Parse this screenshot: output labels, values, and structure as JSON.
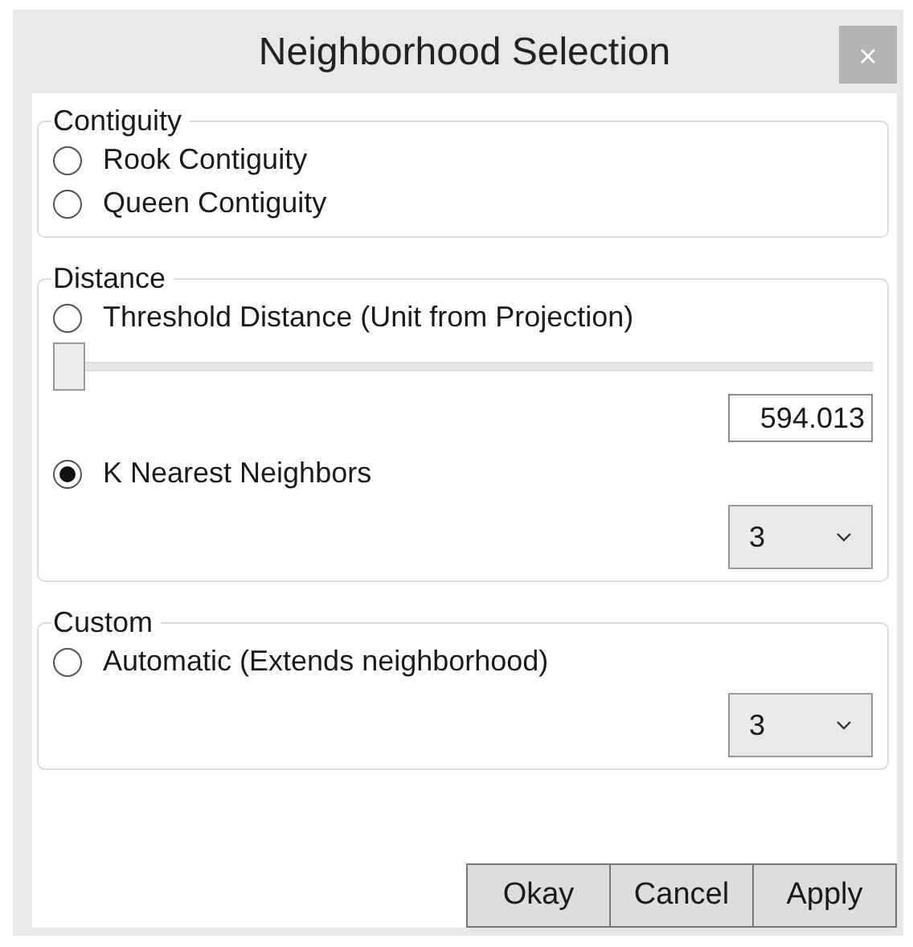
{
  "window": {
    "title": "Neighborhood Selection",
    "close": "×"
  },
  "groups": [
    {
      "title": "Contiguity",
      "items": [
        {
          "kind": "radio",
          "label": "Rook Contiguity",
          "selected": false
        },
        {
          "kind": "radio",
          "label": "Queen Contiguity",
          "selected": false
        }
      ]
    },
    {
      "title": "Distance",
      "items": [
        {
          "kind": "radio",
          "label": "Threshold Distance (Unit from Projection)",
          "selected": false
        },
        {
          "kind": "slider",
          "level": 0
        },
        {
          "kind": "number",
          "value": "594.013"
        },
        {
          "kind": "radio",
          "label": "K Nearest Neighbors",
          "selected": true
        },
        {
          "kind": "dropdown",
          "value": "3"
        }
      ]
    },
    {
      "title": "Custom",
      "items": [
        {
          "kind": "radio",
          "label": "Automatic (Extends neighborhood)",
          "selected": false
        },
        {
          "kind": "dropdown",
          "value": "3"
        }
      ]
    }
  ],
  "buttons": [
    "Okay",
    "Cancel",
    "Apply"
  ]
}
